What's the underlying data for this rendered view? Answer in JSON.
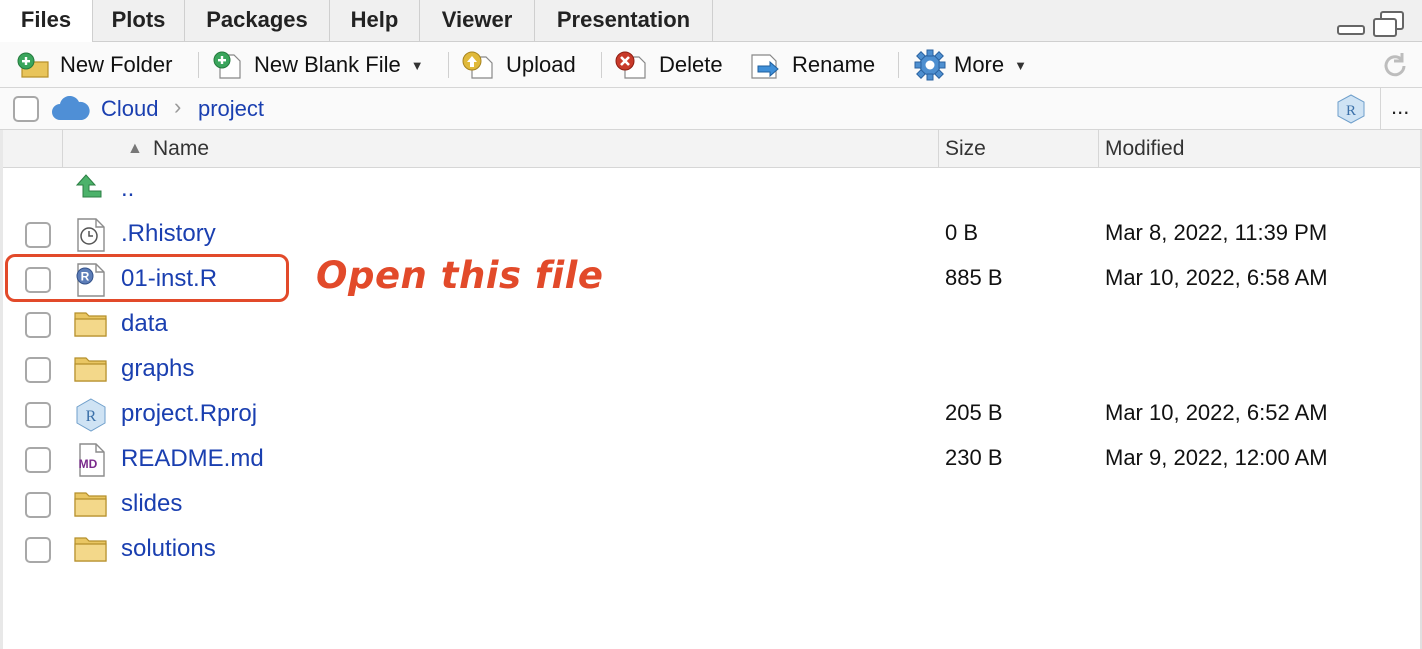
{
  "tabs": [
    {
      "label": "Files",
      "active": true
    },
    {
      "label": "Plots"
    },
    {
      "label": "Packages"
    },
    {
      "label": "Help"
    },
    {
      "label": "Viewer"
    },
    {
      "label": "Presentation"
    }
  ],
  "toolbar": {
    "new_folder": "New Folder",
    "new_blank_file": "New Blank File",
    "upload": "Upload",
    "delete": "Delete",
    "rename": "Rename",
    "more": "More"
  },
  "path": {
    "root": "Cloud",
    "folder": "project",
    "overflow": "..."
  },
  "columns": {
    "name": "Name",
    "size": "Size",
    "modified": "Modified"
  },
  "files": [
    {
      "name": "..",
      "size": "",
      "modified": "",
      "icon": "up-arrow-icon"
    },
    {
      "name": ".Rhistory",
      "size": "0 B",
      "modified": "Mar 8, 2022, 11:39 PM",
      "icon": "history-file-icon"
    },
    {
      "name": "01-inst.R",
      "size": "885 B",
      "modified": "Mar 10, 2022, 6:58 AM",
      "icon": "r-script-icon"
    },
    {
      "name": "data",
      "size": "",
      "modified": "",
      "icon": "folder-icon"
    },
    {
      "name": "graphs",
      "size": "",
      "modified": "",
      "icon": "folder-icon"
    },
    {
      "name": "project.Rproj",
      "size": "205 B",
      "modified": "Mar 10, 2022, 6:52 AM",
      "icon": "rproj-icon"
    },
    {
      "name": "README.md",
      "size": "230 B",
      "modified": "Mar 9, 2022, 12:00 AM",
      "icon": "markdown-file-icon"
    },
    {
      "name": "slides",
      "size": "",
      "modified": "",
      "icon": "folder-icon"
    },
    {
      "name": "solutions",
      "size": "",
      "modified": "",
      "icon": "folder-icon"
    }
  ],
  "annotation": "Open this file",
  "colors": {
    "link": "#1a3fb0",
    "annotation": "#e24a2a"
  }
}
